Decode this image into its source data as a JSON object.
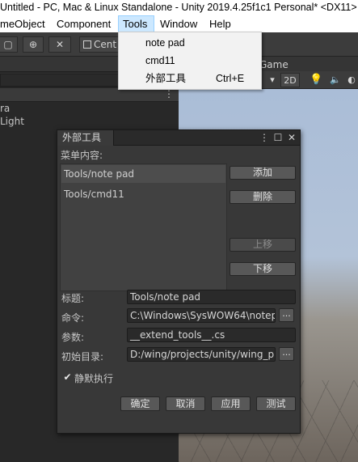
{
  "window": {
    "title": "Untitled - PC, Mac & Linux Standalone - Unity 2019.4.25f1c1 Personal* <DX11>"
  },
  "menubar": {
    "items": [
      "meObject",
      "Component",
      "Tools",
      "Window",
      "Help"
    ]
  },
  "tools_menu": {
    "items": [
      {
        "label": "note pad",
        "shortcut": ""
      },
      {
        "label": "cmd11",
        "shortcut": ""
      },
      {
        "label": "外部工具",
        "shortcut": "Ctrl+E"
      }
    ]
  },
  "toolbar": {
    "center_label": "Cent"
  },
  "hierarchy": {
    "items": [
      "ra",
      "Light"
    ]
  },
  "game_view": {
    "tab_label": "Game",
    "mode_2d": "2D"
  },
  "dialog": {
    "title": "外部工具",
    "menu_content_label": "菜单内容:",
    "list_items": [
      "Tools/note pad",
      "Tools/cmd11"
    ],
    "selected_index": 0,
    "buttons": {
      "add": "添加",
      "delete": "删除",
      "move_up": "上移",
      "move_down": "下移",
      "browse": "..."
    },
    "fields": {
      "title_label": "标题:",
      "title_value": "Tools/note pad",
      "command_label": "命令:",
      "command_value": "C:\\Windows\\SysWOW64\\notep",
      "args_label": "参数:",
      "args_value": "__extend_tools__.cs",
      "initdir_label": "初始目录:",
      "initdir_value": "D:/wing/projects/unity/wing_plu"
    },
    "silent": {
      "label": "静默执行",
      "checked": true
    },
    "footer": {
      "ok": "确定",
      "cancel": "取消",
      "apply": "应用",
      "test": "测试"
    }
  }
}
